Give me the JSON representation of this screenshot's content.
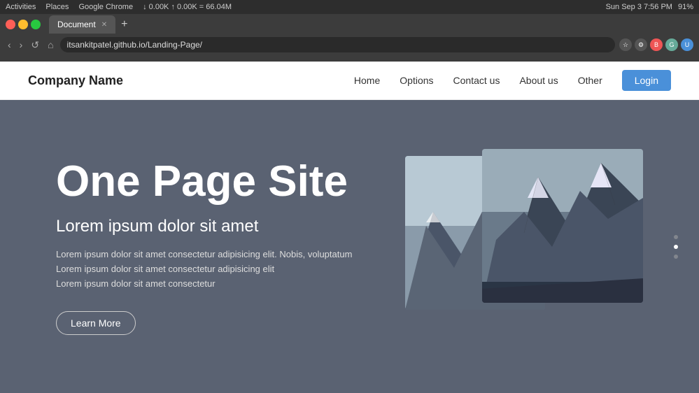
{
  "os_taskbar": {
    "left_items": [
      "Activities",
      "Places",
      "Google Chrome",
      "↓ 0.00K  ↑ 0.00K = 66.04M"
    ],
    "right_text": "Sun Sep 3   7:56 PM",
    "battery": "91%"
  },
  "browser": {
    "tab_label": "Document",
    "url": "itsankitpatel.github.io/Landing-Page/",
    "nav_back": "‹",
    "nav_forward": "›",
    "nav_reload": "↺",
    "nav_home": "⌂"
  },
  "site": {
    "logo": "Company Name",
    "nav": {
      "home": "Home",
      "options": "Options",
      "contact": "Contact us",
      "about": "About us",
      "other": "Other",
      "login": "Login"
    },
    "hero": {
      "title": "One Page Site",
      "subtitle": "Lorem ipsum dolor sit amet",
      "description_line1": "Lorem ipsum dolor sit amet consectetur adipisicing elit. Nobis, voluptatum",
      "description_line2": "Lorem ipsum dolor sit amet consectetur adipisicing elit",
      "description_line3": "Lorem ipsum dolor sit amet consectetur",
      "learn_more": "Learn More"
    },
    "dots": [
      {
        "active": false
      },
      {
        "active": true
      },
      {
        "active": false
      }
    ]
  }
}
